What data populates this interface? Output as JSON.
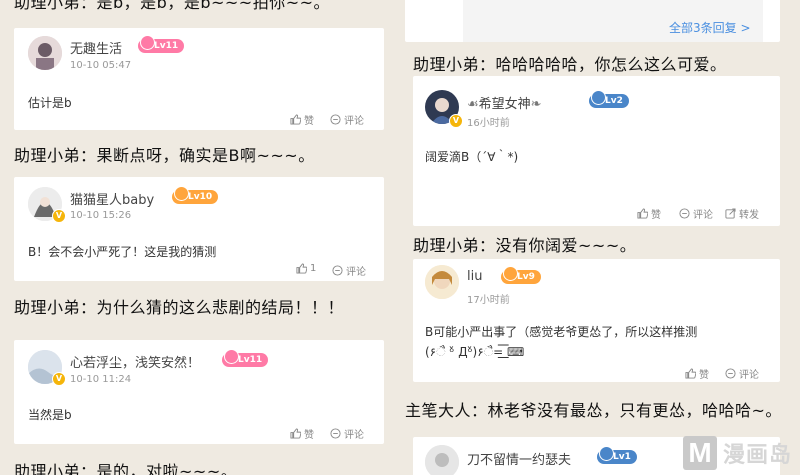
{
  "left": {
    "top_caption": "助理小弟：是b，是b，是b~~~拍你~~。",
    "comments": [
      {
        "name": "无趣生活",
        "level": "Lv11",
        "time": "10-10 05:47",
        "text": "估计是b",
        "like": "赞",
        "comment": "评论"
      },
      {
        "name": "猫猫星人baby",
        "level": "Lv10",
        "time": "10-10 15:26",
        "text": "B！会不会小严死了！这是我的猜测",
        "like": "1",
        "comment": "评论"
      },
      {
        "name": "心若浮尘，浅笑安然！",
        "level": "Lv11",
        "time": "10-10 11:24",
        "text": "当然是b",
        "like": "赞",
        "comment": "评论"
      }
    ],
    "captions": [
      "助理小弟：果断点呀，确实是B啊~~~。",
      "助理小弟：为什么猜的这么悲剧的结局！！！",
      "助理小弟：是的，对啦~~~。"
    ]
  },
  "right": {
    "reply_link": "全部3条回复 >",
    "captions": [
      "助理小弟：哈哈哈哈哈，你怎么这么可爱。",
      "助理小弟：没有你阔爱~~~。",
      "主笔大人：林老爷没有最怂，只有更怂，哈哈哈~。"
    ],
    "comments": [
      {
        "name": "希望女神",
        "level": "Lv2",
        "time": "16小时前",
        "text": "阔爱滴B（´∀｀*)",
        "like": "赞",
        "comment": "评论",
        "share": "转发"
      },
      {
        "name": "liu",
        "level": "Lv9",
        "time": "17小时前",
        "text": "B可能小严出事了（感觉老爷更怂了，所以这样推测",
        "text2": "(۶ૈ ᵒ̌ Дᵒ̌)۶ૈ=͟͟͞͞ ⌨",
        "like": "赞",
        "comment": "评论"
      },
      {
        "name": "刀不留情一约瑟夫",
        "level": "Lv1"
      }
    ]
  },
  "watermark": {
    "letter": "M",
    "text": "漫画岛"
  }
}
